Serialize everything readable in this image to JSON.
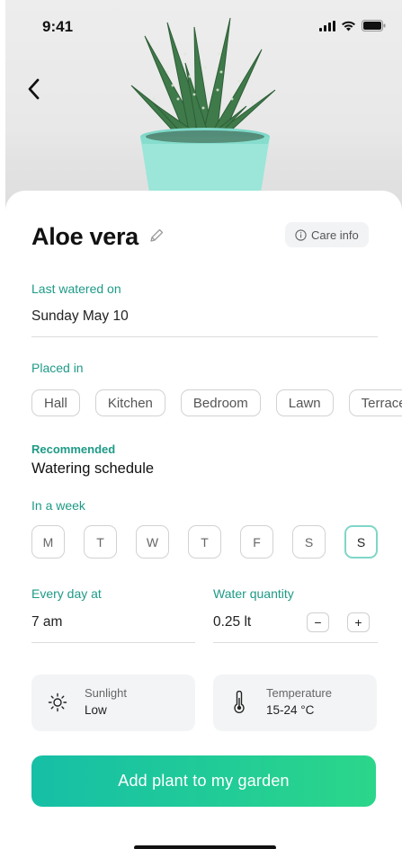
{
  "status_bar": {
    "time": "9:41",
    "icons": [
      "signal-icon",
      "wifi-icon",
      "battery-icon"
    ]
  },
  "header": {
    "back_icon": "chevron-left-icon"
  },
  "plant": {
    "name": "Aloe vera",
    "edit_icon": "pencil-icon"
  },
  "care_info": {
    "label": "Care info",
    "icon": "info-icon"
  },
  "last_watered": {
    "label": "Last watered on",
    "value": "Sunday May 10"
  },
  "placement": {
    "label": "Placed in",
    "options": [
      "Hall",
      "Kitchen",
      "Bedroom",
      "Lawn",
      "Terrace"
    ]
  },
  "schedule": {
    "recommended_label": "Recommended",
    "title": "Watering schedule",
    "week_label": "In a week",
    "days": [
      "M",
      "T",
      "W",
      "T",
      "F",
      "S",
      "S"
    ],
    "selected_day_index": 6
  },
  "time": {
    "label": "Every day at",
    "value": "7 am"
  },
  "quantity": {
    "label": "Water quantity",
    "value": "0.25 lt",
    "minus": "−",
    "plus": "+"
  },
  "conditions": {
    "sunlight": {
      "title": "Sunlight",
      "value": "Low",
      "icon": "sun-icon"
    },
    "temperature": {
      "title": "Temperature",
      "value": "15-24 °C",
      "icon": "thermometer-icon"
    }
  },
  "cta": {
    "label": "Add plant to my garden"
  },
  "colors": {
    "accent": "#1e9a86",
    "cta_start": "#16bfa6",
    "cta_end": "#2bd68a",
    "selected_border": "#7fd6c8"
  }
}
